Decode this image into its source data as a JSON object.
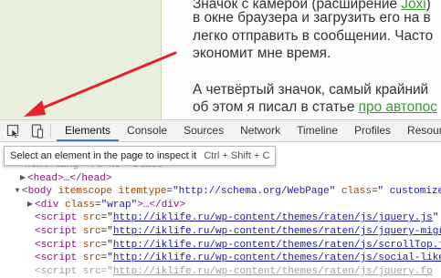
{
  "article": {
    "line1": "Значок с камерой (расширение ",
    "line1_link": "Joxi",
    "line1_end": ")",
    "line2": "в окне браузера и загрузить его на в",
    "line3": "легко отправить в сообщении. Часто",
    "line4": "экономит мне время.",
    "line5": "А четвёртый значок, самый крайний",
    "line6_start": "об этом я писал в статье ",
    "line6_link": "про автопос"
  },
  "toolbar": {
    "inspect_icon": "inspect-cursor-icon",
    "device_icon": "device-mode-icon",
    "tabs": [
      "Elements",
      "Console",
      "Sources",
      "Network",
      "Timeline",
      "Profiles",
      "Resources"
    ],
    "active_tab": "Elements"
  },
  "tooltip": {
    "text": "Select an element in the page to inspect it",
    "shortcut": "Ctrl + Shift + C"
  },
  "dom": {
    "line0": "<html lang=\"ru-RU\" class>",
    "head_open": "<head>",
    "head_ellipsis": "…",
    "head_close": "</head>",
    "body_open": "<body",
    "body_attr1": "itemscope",
    "body_attr2": "itemtype",
    "body_val2": "\"http://schema.org/WebPage\"",
    "body_attr3": "class",
    "body_val3": "\" customize-",
    "div_open": "<div",
    "div_attr": "class",
    "div_val": "\"wrap\"",
    "div_ellipsis": ">…",
    "div_close": "</div>",
    "script_open": "<script",
    "script_attr": "src",
    "script_eq": "=\"",
    "scripts": [
      "http://iklife.ru/wp-content/themes/raten/js/jquery.js",
      "http://iklife.ru/wp-content/themes/raten/js/jquery-migr",
      "http://iklife.ru/wp-content/themes/raten/js/scrollTop.js",
      "http://iklife.ru/wp-content/themes/raten/js/social-like",
      "http://iklife.ru/wp-content/themes/raten/js/jquery.fo"
    ]
  },
  "colors": {
    "active_tab_underline": "#3879d9",
    "arrow": "#e8212b",
    "link": "#3a9b35"
  }
}
